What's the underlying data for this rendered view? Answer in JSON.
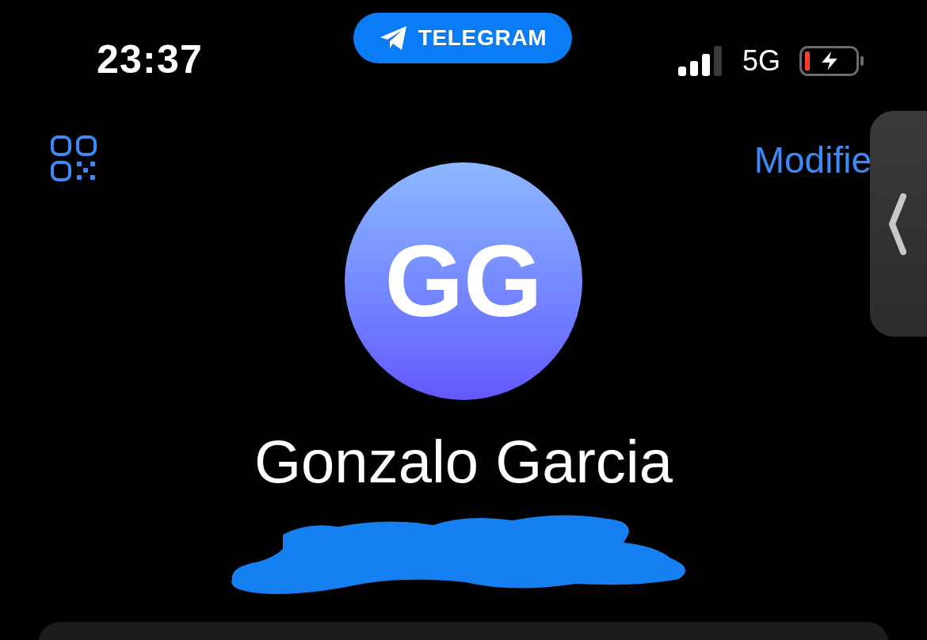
{
  "status_bar": {
    "time": "23:37",
    "network": "5G"
  },
  "app_badge": {
    "label": "TELEGRAM"
  },
  "nav": {
    "edit_label": "Modifie"
  },
  "profile": {
    "initials": "GG",
    "name": "Gonzalo Garcia"
  }
}
